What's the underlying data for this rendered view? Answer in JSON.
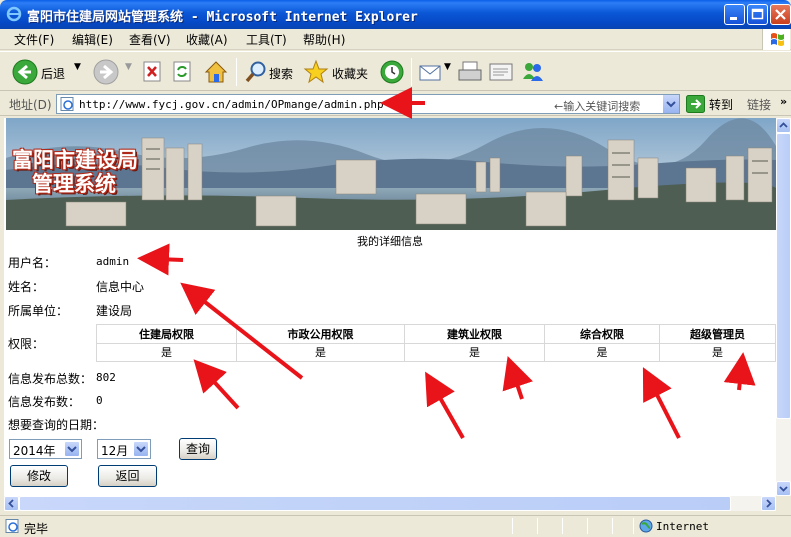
{
  "window": {
    "title": "富阳市住建局网站管理系统 - Microsoft Internet Explorer"
  },
  "menu": [
    "文件(F)",
    "编辑(E)",
    "查看(V)",
    "收藏(A)",
    "工具(T)",
    "帮助(H)"
  ],
  "toolbar": {
    "back": "后退",
    "search": "搜索",
    "favorites": "收藏夹"
  },
  "address": {
    "label": "地址(D)",
    "url": "http://www.fycj.gov.cn/admin/OPmange/admin.php",
    "search_hint": "←输入关键词搜索",
    "go": "转到",
    "links": "链接"
  },
  "banner": {
    "title_line1": "富阳市建设局",
    "title_line2": "管理系统"
  },
  "info": {
    "section_title": "我的详细信息",
    "username_label": "用户名：",
    "username": "admin",
    "name_label": "姓名：",
    "name": "信息中心",
    "unit_label": "所属单位：",
    "unit": "建设局",
    "permission_label": "权限：",
    "permission_headers": [
      "住建局权限",
      "市政公用权限",
      "建筑业权限",
      "综合权限",
      "超级管理员"
    ],
    "permission_values": [
      "是",
      "是",
      "是",
      "是",
      "是"
    ],
    "total_label": "信息发布总数：",
    "total": "802",
    "count_label": "信息发布数：",
    "count": "0",
    "date_label": "想要查询的日期：",
    "year": "2014年",
    "month": "12月",
    "query_button": "查询",
    "edit_button": "修改",
    "back_button": "返回"
  },
  "status": {
    "text": "完毕",
    "zone": "Internet"
  },
  "colors": {
    "titlebar": "#0A57D6",
    "annotation_arrow": "#E8141A",
    "chrome": "#ECE9D8"
  }
}
